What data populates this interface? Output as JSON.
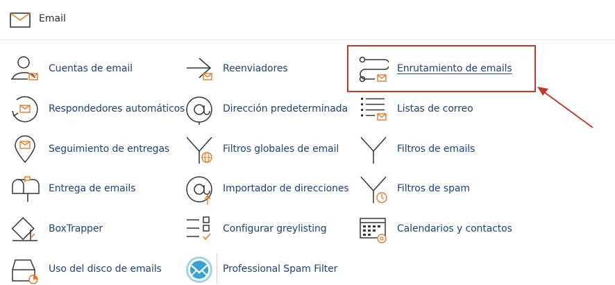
{
  "header": {
    "title": "Email",
    "icon": "envelope-icon"
  },
  "accent_color": "#e87722",
  "link_color": "#20427a",
  "highlight_color": "#c0392b",
  "columns": [
    [
      {
        "label": "Cuentas de email",
        "icon": "user-mail-icon"
      },
      {
        "label": "Respondedores automáticos",
        "icon": "autoresponder-icon"
      },
      {
        "label": "Seguimiento de entregas",
        "icon": "location-pin-icon"
      },
      {
        "label": "Entrega de emails",
        "icon": "mailbox-icon"
      },
      {
        "label": "BoxTrapper",
        "icon": "trap-icon"
      },
      {
        "label": "Uso del disco de emails",
        "icon": "disk-usage-icon"
      }
    ],
    [
      {
        "label": "Reenviadores",
        "icon": "forward-arrow-icon"
      },
      {
        "label": "Dirección predeterminada",
        "icon": "at-sign-icon"
      },
      {
        "label": "Filtros globales de email",
        "icon": "funnel-globe-icon"
      },
      {
        "label": "Importador de direcciones",
        "icon": "at-import-icon"
      },
      {
        "label": "Configurar greylisting",
        "icon": "checklist-icon"
      },
      {
        "label": "Professional Spam Filter",
        "icon": "spam-filter-logo-icon"
      }
    ],
    [
      {
        "label": "Enrutamiento de emails",
        "icon": "routing-icon"
      },
      {
        "label": "Listas de correo",
        "icon": "mailing-list-icon"
      },
      {
        "label": "Filtros de emails",
        "icon": "funnel-icon"
      },
      {
        "label": "Filtros de spam",
        "icon": "funnel-clock-icon"
      },
      {
        "label": "Calendarios y contactos",
        "icon": "calendar-icon"
      }
    ]
  ]
}
